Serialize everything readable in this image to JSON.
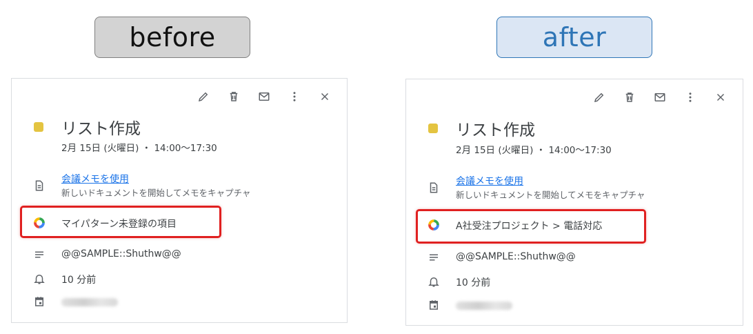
{
  "labels": {
    "before": "before",
    "after": "after"
  },
  "before": {
    "title": "リスト作成",
    "datetime": "2月 15日 (火曜日) ・ 14:00〜17:30",
    "meet_link": "会議メモを使用",
    "meet_sub": "新しいドキュメントを開始してメモをキャプチャ",
    "category": "マイパターン未登録の項目",
    "description": "@@SAMPLE::Shuthw@@",
    "reminder": "10 分前"
  },
  "after": {
    "title": "リスト作成",
    "datetime": "2月 15日 (火曜日) ・ 14:00〜17:30",
    "meet_link": "会議メモを使用",
    "meet_sub": "新しいドキュメントを開始してメモをキャプチャ",
    "category": "A社受注プロジェクト > 電話対応",
    "description": "@@SAMPLE::Shuthw@@",
    "reminder": "10 分前"
  },
  "colors": {
    "event_dot": "#e4c441",
    "highlight": "#e02020",
    "link": "#1a73e8"
  },
  "icons": [
    "edit-icon",
    "delete-icon",
    "mail-icon",
    "more-icon",
    "close-icon",
    "document-icon",
    "color-ring-icon",
    "notes-icon",
    "bell-icon",
    "calendar-icon"
  ]
}
